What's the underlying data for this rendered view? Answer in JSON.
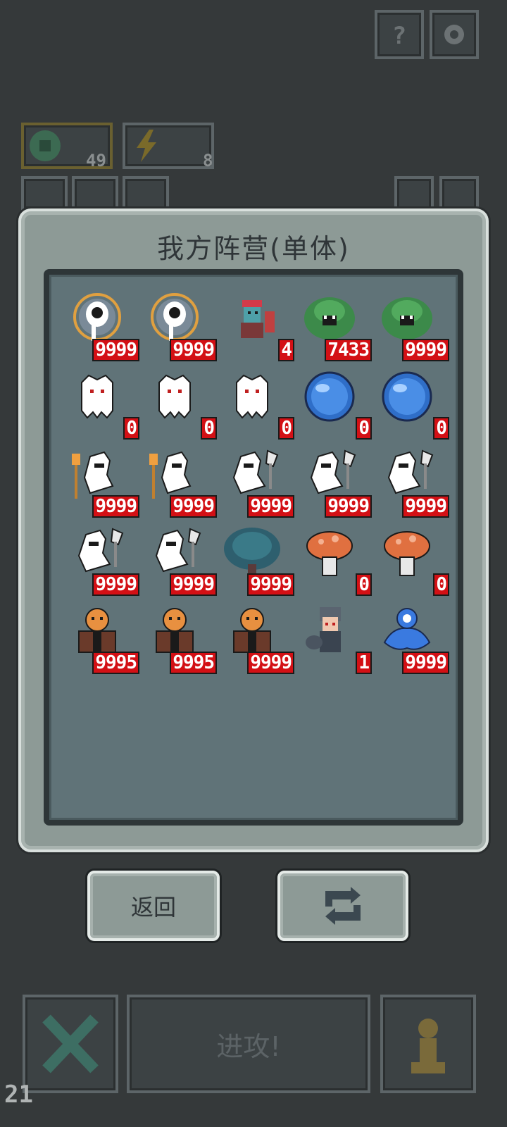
{
  "dialog": {
    "title": "我方阵营(单体)"
  },
  "buttons": {
    "back_label": "返回",
    "refresh_icon": "refresh-cycle-icon"
  },
  "background": {
    "resource_a_count": "49",
    "resource_b_count": "8",
    "attack_label": "进攻!",
    "turn_number": "21"
  },
  "units": [
    {
      "name": "ghost-halo",
      "count": "9999"
    },
    {
      "name": "ghost-halo",
      "count": "9999"
    },
    {
      "name": "goblin-warrior",
      "count": "4"
    },
    {
      "name": "green-bush-monster",
      "count": "7433"
    },
    {
      "name": "green-bush-monster",
      "count": "9999"
    },
    {
      "name": "white-ghost",
      "count": "0"
    },
    {
      "name": "white-ghost",
      "count": "0"
    },
    {
      "name": "white-ghost",
      "count": "0"
    },
    {
      "name": "blue-orb",
      "count": "0"
    },
    {
      "name": "blue-orb",
      "count": "0"
    },
    {
      "name": "white-knight-lamp",
      "count": "9999"
    },
    {
      "name": "white-knight-lamp",
      "count": "9999"
    },
    {
      "name": "white-knight-axe",
      "count": "9999"
    },
    {
      "name": "white-knight-axe",
      "count": "9999"
    },
    {
      "name": "white-knight-axe",
      "count": "9999"
    },
    {
      "name": "white-knight-axe",
      "count": "9999"
    },
    {
      "name": "white-knight-axe",
      "count": "9999"
    },
    {
      "name": "teal-tree",
      "count": "9999"
    },
    {
      "name": "orange-mushroom",
      "count": "0"
    },
    {
      "name": "orange-mushroom",
      "count": "0"
    },
    {
      "name": "pumpkin-brute",
      "count": "9995"
    },
    {
      "name": "pumpkin-brute",
      "count": "9995"
    },
    {
      "name": "pumpkin-brute",
      "count": "9999"
    },
    {
      "name": "hooded-rogue",
      "count": "1"
    },
    {
      "name": "blue-slime",
      "count": "9999"
    }
  ],
  "colors": {
    "count_badge": "#d31015",
    "panel": "#607378",
    "dialog": "#8d9a96"
  }
}
